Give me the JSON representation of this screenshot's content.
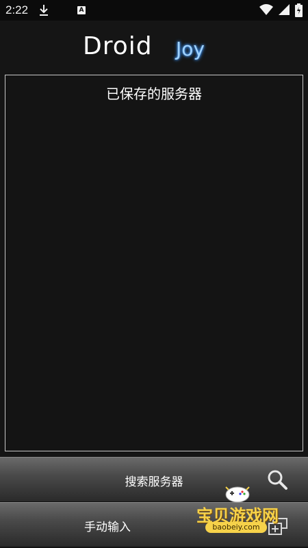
{
  "status_bar": {
    "time": "2:22",
    "icons": [
      "download-icon",
      "a-notification-icon",
      "wifi-icon",
      "signal-icon",
      "battery-icon"
    ]
  },
  "logo": {
    "part1": "Droid",
    "part2": "Joy"
  },
  "servers_panel": {
    "title": "已保存的服务器",
    "items": []
  },
  "buttons": {
    "search_label": "搜索服务器",
    "manual_label": "手动输入"
  },
  "watermark": {
    "text": "宝贝游戏网",
    "url": "baobeiy.com"
  },
  "colors": {
    "background": "#151515",
    "accent_joy": "#9fd2ff",
    "button_top": "#6a6a6a",
    "button_bottom": "#2a2a2a"
  }
}
